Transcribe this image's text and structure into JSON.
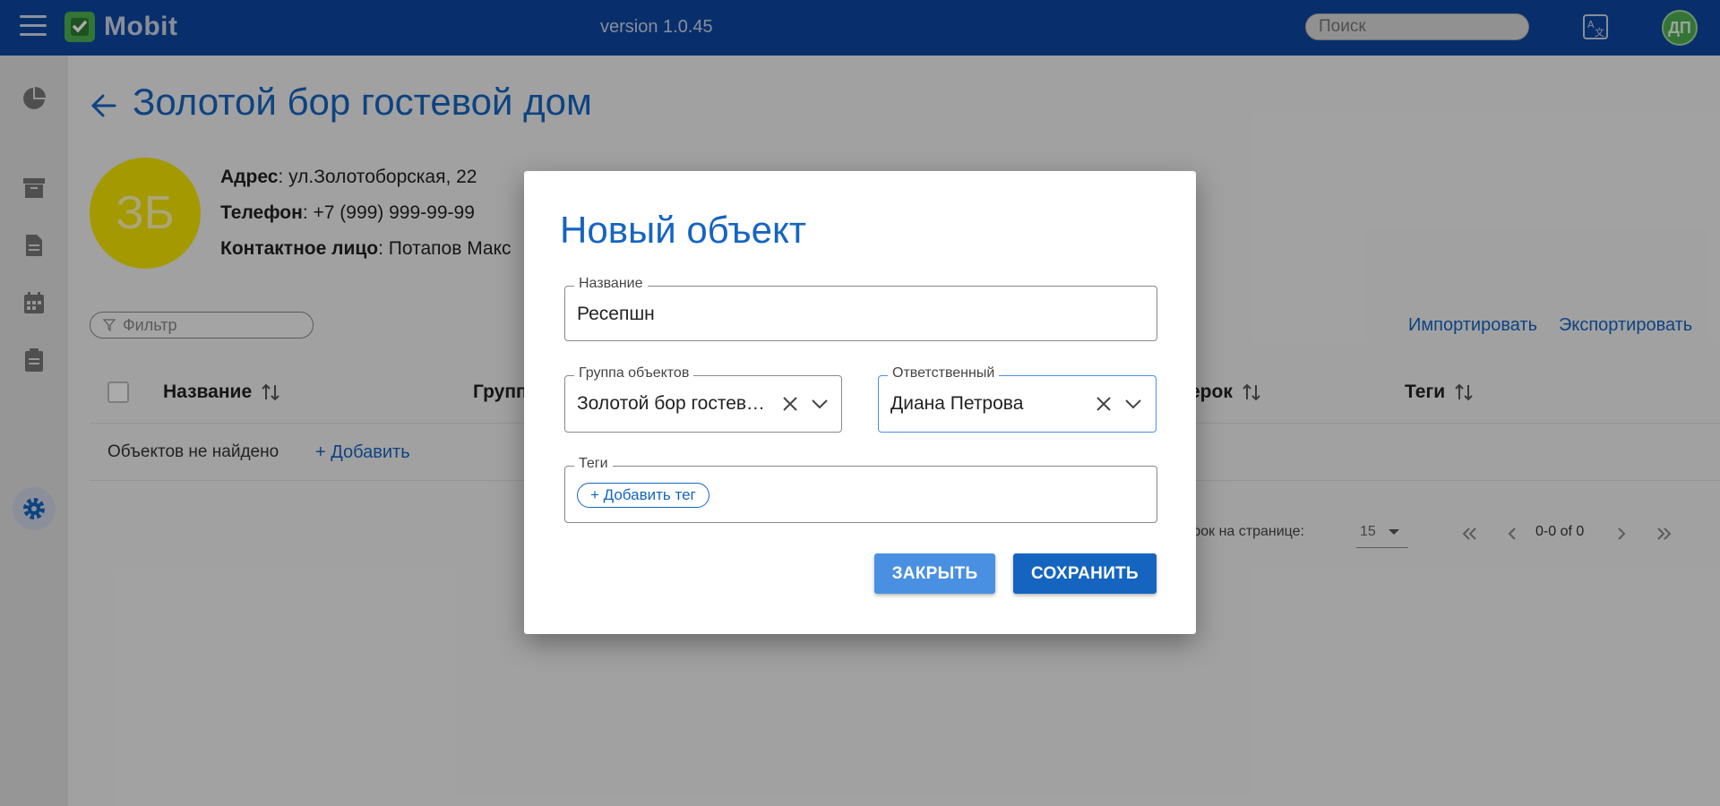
{
  "app": {
    "name": "Mobit",
    "version": "version 1.0.45",
    "search_placeholder": "Поиск",
    "user_initials": "ДП"
  },
  "page": {
    "title": "Золотой бор гостевой дом",
    "avatar_initials": "ЗБ",
    "address_label": "Адрес",
    "address_value": ": ул.Золотоборская, 22",
    "phone_label": "Телефон",
    "phone_value": ": +7 (999) 999-99-99",
    "contact_label": "Контактное лицо",
    "contact_value": ": Потапов Макс",
    "filter_placeholder": "Фильтр",
    "import_label": "Импортировать",
    "export_label": "Экспортировать",
    "columns": [
      "Название",
      "Групп",
      "ерок",
      "Теги"
    ],
    "empty_text": "Объектов не найдено",
    "add_label": "+ Добавить",
    "pagination": {
      "rows_label": "трок на странице:",
      "rows_value": "15",
      "count": "0-0 of 0"
    }
  },
  "dialog": {
    "title": "Новый объект",
    "name_label": "Название",
    "name_value": "Ресепшн",
    "group_label": "Группа объектов",
    "group_value": "Золотой бор гостевой дом",
    "responsible_label": "Ответственный",
    "responsible_value": "Диана Петрова",
    "tags_label": "Теги",
    "add_tag_label": "+ Добавить тег",
    "close_label": "ЗАКРЫТЬ",
    "save_label": "СОХРАНИТЬ"
  },
  "colors": {
    "topbar": "#0d47a1",
    "accent": "#1565c0",
    "logo_green": "#4caf50",
    "avatar_yellow": "#f5e400"
  },
  "icons": {
    "menu": "menu-icon",
    "logo": "check-logo-icon",
    "translate": "translate-icon",
    "sidebar": [
      "pie-chart-icon",
      "archive-icon",
      "document-icon",
      "calendar-icon",
      "clipboard-icon",
      "gear-icon"
    ]
  }
}
